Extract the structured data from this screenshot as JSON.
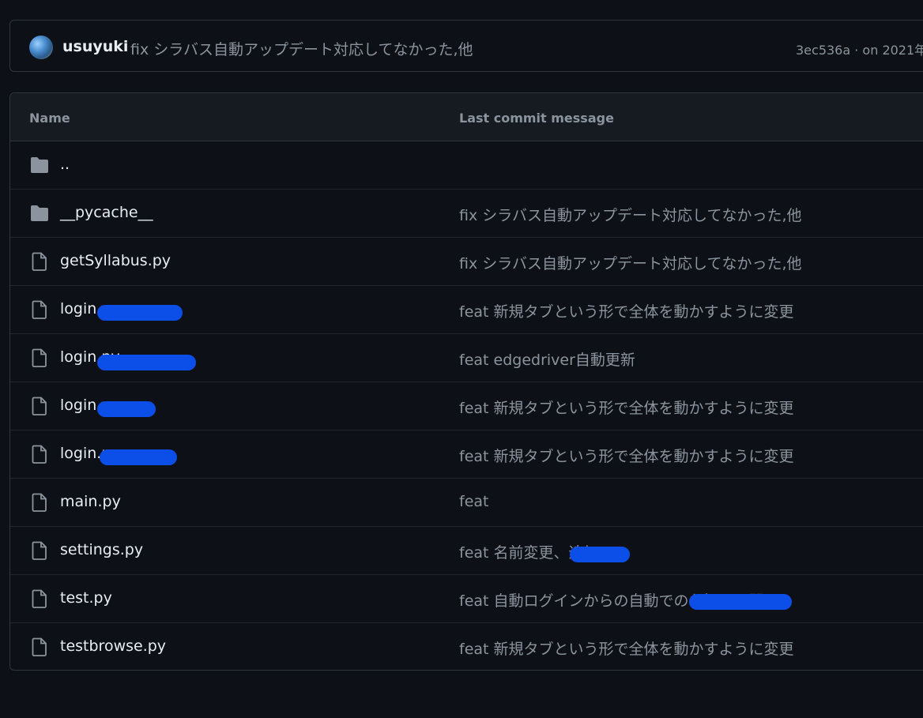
{
  "commit_bar": {
    "author": "usuyuki",
    "message": "fix シラバス自動アップデート対応してなかった,他",
    "meta": "3ec536a · on 2021年"
  },
  "table": {
    "header_name": "Name",
    "header_commit": "Last commit message",
    "rows": [
      {
        "icon": "folder-icon",
        "name": "..",
        "commit": ""
      },
      {
        "icon": "folder-icon",
        "name": "__pycache__",
        "commit": "fix シラバス自動アップデート対応してなかった,他"
      },
      {
        "icon": "file-icon",
        "name": "getSyllabus.py",
        "commit": "fix シラバス自動アップデート対応してなかった,他"
      },
      {
        "icon": "file-icon",
        "name": "login.py",
        "commit": "feat 新規タブという形で全体を動かすように変更"
      },
      {
        "icon": "file-icon",
        "name": "login.py",
        "commit": "feat edgedriver自動更新"
      },
      {
        "icon": "file-icon",
        "name": "login.py",
        "commit": "feat 新規タブという形で全体を動かすように変更"
      },
      {
        "icon": "file-icon",
        "name": "login.py",
        "commit": "feat 新規タブという形で全体を動かすように変更"
      },
      {
        "icon": "file-icon",
        "name": "main.py",
        "commit": "feat"
      },
      {
        "icon": "file-icon",
        "name": "settings.py",
        "commit": "feat 名前変更、追加"
      },
      {
        "icon": "file-icon",
        "name": "test.py",
        "commit": "feat 自動ログインからの自動でのお知らせ開く"
      },
      {
        "icon": "file-icon",
        "name": "testbrowse.py",
        "commit": "feat 新規タブという形で全体を動かすように変更"
      }
    ]
  }
}
